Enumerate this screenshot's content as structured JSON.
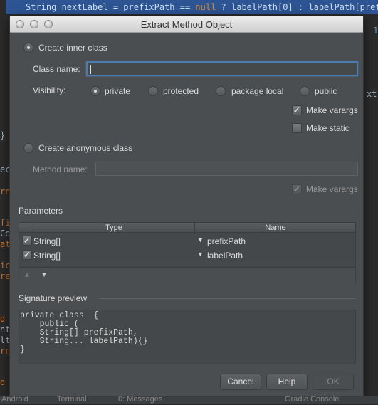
{
  "editor": {
    "highlighted_line": {
      "pre": "String nextLabel = prefixPath == ",
      "keyword": "null",
      "post": " ? labelPath[0] : labelPath[prefixP"
    },
    "fragments": [
      "}",
      "ec",
      "rn",
      "fi",
      "Co",
      "at",
      "ic",
      "re",
      "d",
      "nt",
      "lt",
      "rn",
      "d",
      "1",
      "xt"
    ]
  },
  "dialog": {
    "title": "Extract Method Object",
    "create_inner_class": {
      "label": "Create inner class",
      "selected": true
    },
    "class_name": {
      "label": "Class name:",
      "value": ""
    },
    "visibility": {
      "label": "Visibility:",
      "options": [
        "private",
        "protected",
        "package local",
        "public"
      ],
      "selected": "private"
    },
    "make_varargs": {
      "label": "Make varargs",
      "checked": true
    },
    "make_static": {
      "label": "Make static",
      "checked": false
    },
    "create_anonymous_class": {
      "label": "Create anonymous class",
      "selected": false
    },
    "method_name": {
      "label": "Method name:",
      "value": ""
    },
    "make_varargs_anon": {
      "label": "Make varargs",
      "checked": true,
      "disabled": true
    },
    "parameters": {
      "label": "Parameters",
      "columns": [
        "Type",
        "Name"
      ],
      "rows": [
        {
          "checked": true,
          "type": "String[]",
          "name": "prefixPath"
        },
        {
          "checked": true,
          "type": "String[]",
          "name": "labelPath"
        }
      ]
    },
    "signature_preview": {
      "label": "Signature preview",
      "text": "private class  {\n    public (\n    String[] prefixPath,\n    String... labelPath){}\n}"
    },
    "buttons": {
      "cancel": "Cancel",
      "help": "Help",
      "ok": "OK"
    }
  },
  "status_bar": {
    "items": [
      "Android",
      "Terminal",
      "0: Messages",
      "Gradle Console"
    ]
  },
  "colors": {
    "focus": "#4a7eb0",
    "selection": "#2d5594",
    "keyword": "#cc7832"
  }
}
